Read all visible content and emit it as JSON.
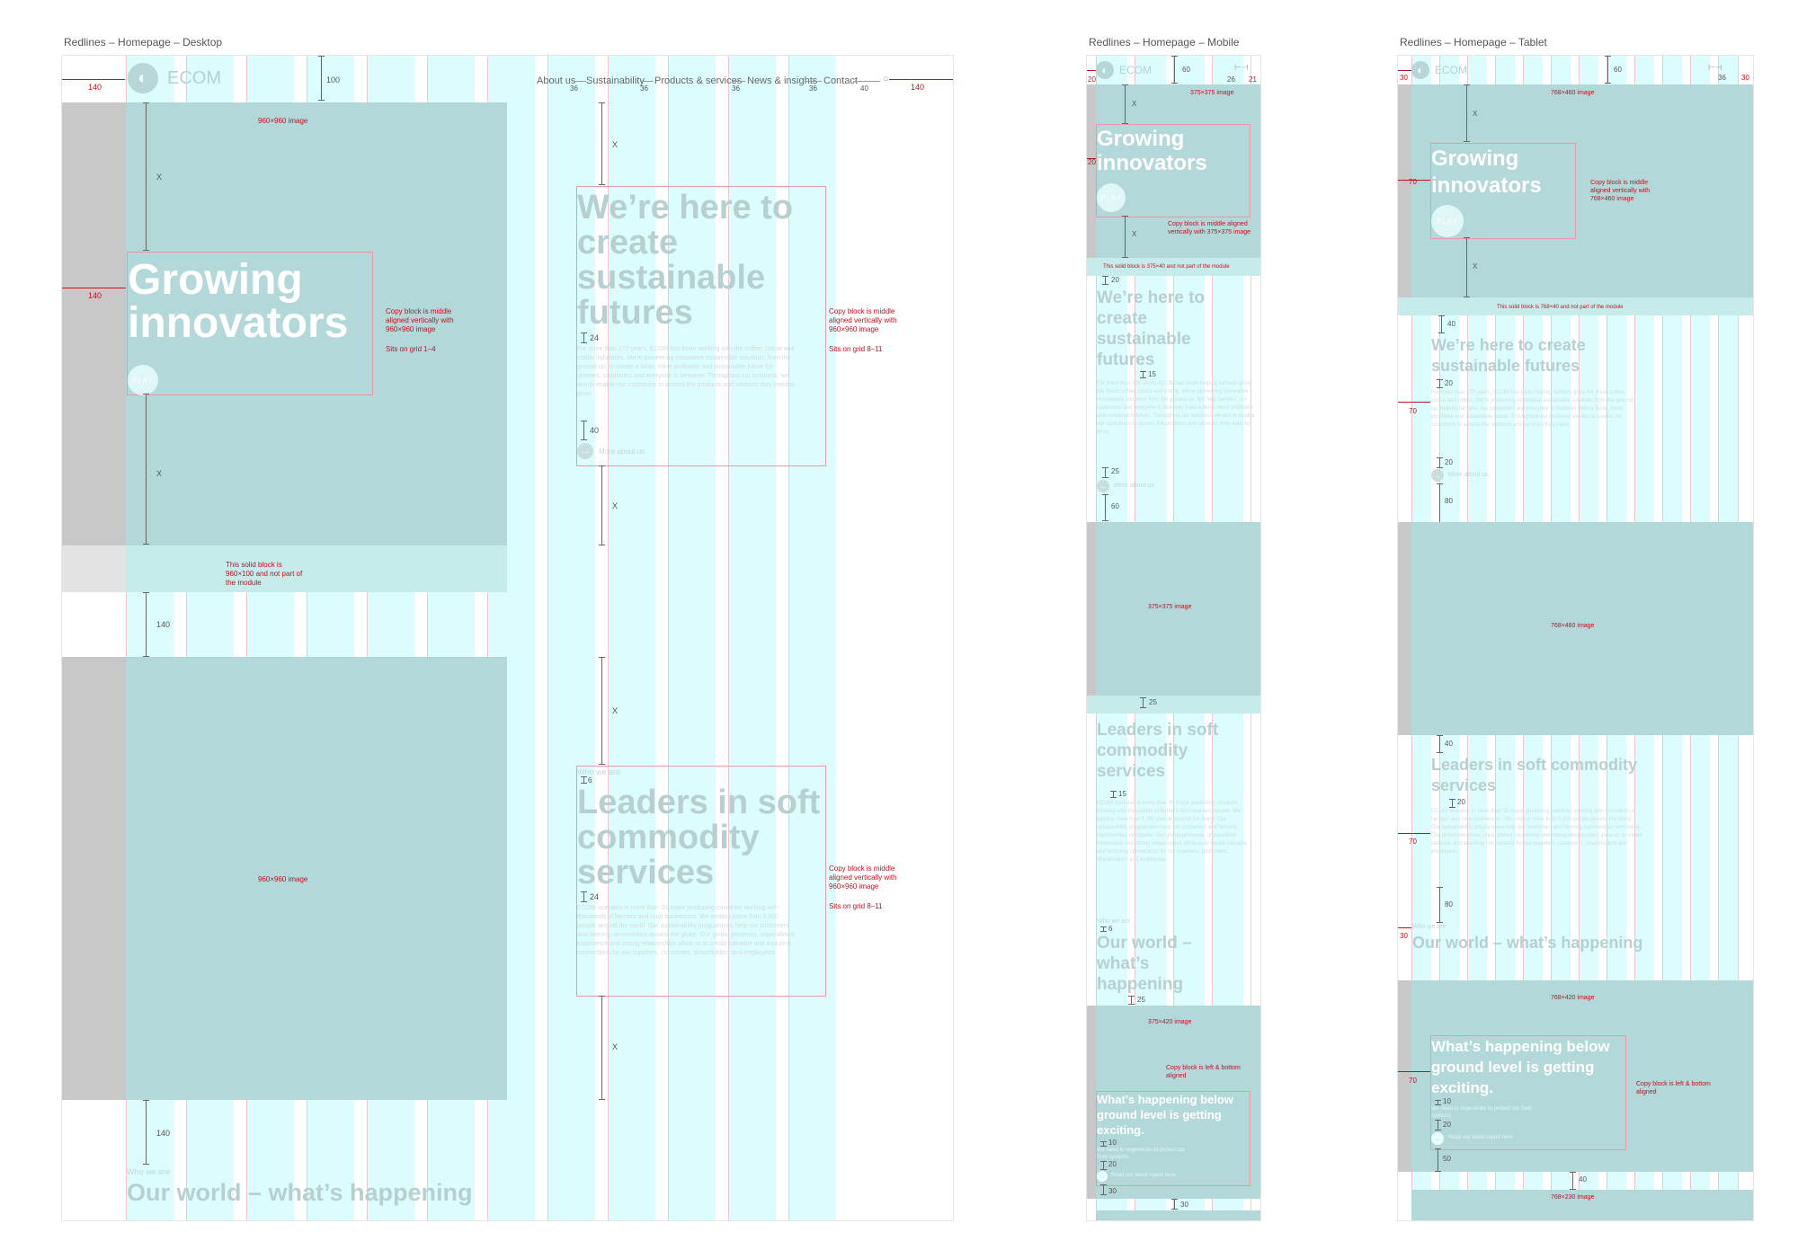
{
  "frames": {
    "desktop_title": "Redlines – Homepage – Desktop",
    "mobile_title": "Redlines – Homepage – Mobile",
    "tablet_title": "Redlines – Homepage – Tablet"
  },
  "brand": {
    "logo_text": "ECOM",
    "logo_icon": "globe-logo-icon",
    "play_label": "PLAY"
  },
  "colors": {
    "guide_red": "#c0121f",
    "grid_cyan": "#dcfdfd",
    "image_teal": "#b2d8d9",
    "gutter_grey": "#c8c8c8"
  },
  "desktop": {
    "nav": [
      "About us",
      "Sustainability",
      "Products & services",
      "News & insights",
      "Contact"
    ],
    "nav_gaps": [
      "36",
      "36",
      "36",
      "36",
      "40"
    ],
    "margins": {
      "left": "140",
      "right": "140",
      "header_height": "100",
      "section_gap": "140"
    },
    "hero": {
      "image_label": "960×960 image",
      "title": "Growing innovators",
      "x": "X",
      "note": "Copy block is middle aligned vertically with 960×960 image",
      "grid_note": "Sits on grid 1–4",
      "band_note": "This solid block is 960×100 and not part of the module"
    },
    "about": {
      "title": "We’re here to create sustainable futures",
      "body": "For more than 170 years, ECOM has been working with the coffee, cocoa and cotton industries. We're pioneering innovative sustainable solutions, from the ground up, to create a fairer, more profitable and sustainable future for growers, customers and everyone in between. Throughout our business, we aim to enable our customers to access the products and services they need to grow.",
      "gap_title": "24",
      "gap_cta": "40",
      "cta": "More about us",
      "note": "Copy block is middle aligned vertically with 960×960 image",
      "grid_note": "Sits on grid 8–11"
    },
    "second": {
      "image_label": "960×960 image",
      "eyebrow": "Who we are",
      "gap_eyebrow": "6",
      "title": "Leaders in soft commodity services",
      "gap_title": "24",
      "body": "ECOM operates in more than 35 major producing countries working with thousands of farmers and rural businesses. We employ more than 5,000 people around the world. Our sustainability programmes help our customers and farming communities around the globe. Our global presence, unparalleled experience and strong relationships allow us to create valuable and enduring connections for our suppliers, customers, shareholders and employees.",
      "note": "Copy block is middle aligned vertically with 960×960 image",
      "grid_note": "Sits on grid 8–11",
      "x": "X"
    },
    "world": {
      "eyebrow": "Who we are",
      "title": "Our world – what’s happening",
      "gap": "140"
    }
  },
  "mobile": {
    "margin": "20",
    "header_height": "60",
    "right_a": "26",
    "right_b": "21",
    "hero": {
      "image_label": "375×375 image",
      "title": "Growing innovators",
      "x": "X",
      "note": "Copy block is middle aligned vertically with 375×375 image",
      "band_note": "This solid block is 375×40 and not part of the module"
    },
    "about": {
      "gap_top": "20",
      "title": "We’re here to create sustainable futures",
      "gap_title": "15",
      "body": "For more than 170 years, ECOM has been helping farmers grow the finest coffee, cocoa and cotton. We're pioneering innovative sustainable solutions from the ground up. We help farmers, our customers and everyone in between build a fairer, more profitable and sustainable future. Throughout our business we aim to enable our customers to access the products and services they need to grow.",
      "gap_cta": "25",
      "cta": "More about us",
      "gap_bottom": "60"
    },
    "second": {
      "image_label": "375×375 image",
      "gap_top": "25",
      "title": "Leaders in soft commodity services",
      "gap_title": "15",
      "body": "ECOM operates in more than 35 major producing countries working with thousands of farmers and rural businesses. We employ more than 5,000 people around the world. Our sustainability programmes help our customers and farming communities worldwide. Our global presence, unparalleled experience and strong relationships allow us to create valuable and enduring connections for our suppliers, customers, shareholders and employees.",
      "eyebrow": "Who we are",
      "gap_eyebrow": "6"
    },
    "world": {
      "title": "Our world – what’s happening",
      "gap": "25",
      "image_label": "375×420 image",
      "note": "Copy block is left & bottom aligned",
      "card_title": "What’s happening below ground level is getting exciting.",
      "gap_title": "10",
      "card_body": "We need to regenerate to protect our food systems.",
      "gap_cta": "20",
      "cta": "Read our latest report here",
      "gap_bottom": "30",
      "gap_bottom_b": "30"
    }
  },
  "tablet": {
    "margin": "30",
    "header_height": "60",
    "right_a": "36",
    "right_b": "30",
    "hero": {
      "image_label": "768×460 image",
      "title": "Growing innovators",
      "x": "X",
      "margin": "70",
      "note": "Copy block is middle aligned vertically with 768×460 image",
      "band_note": "This solid block is 768×40 and not part of the module"
    },
    "about": {
      "gap_top": "40",
      "title": "We’re here to create sustainable futures",
      "gap_title": "20",
      "body": "For more than 170 years, ECOM has been helping farmers grow the finest coffee, cocoa and cotton. We're pioneering innovative sustainable solutions from the ground up, helping farmers, our customers and everyone in between build a fairer, more profitable and sustainable future. Throughout our business we aim to enable our customers to access the products and services they need.",
      "gap_cta": "20",
      "cta": "More about us",
      "gap_bottom": "80",
      "margin": "70"
    },
    "second": {
      "image_label": "768×460 image",
      "gap_top": "40",
      "title": "Leaders in soft commodity services",
      "gap_title": "20",
      "body": "ECOM operates in more than 35 major producing countries working with thousands of farmers and rural businesses. We employ more than 5,000 people around the world. Our sustainability programmes help our customers and farming communities worldwide. Our global presence, unparalleled experience and strong relationships allow us to create valuable and enduring connections for our suppliers, customers, shareholders and employees.",
      "gap_bottom": "80",
      "margin": "70",
      "eyebrow": "Who we are",
      "eyebrow_margin": "30"
    },
    "world": {
      "title": "Our world – what’s happening",
      "image_label": "768×420 image",
      "card_title": "What’s happening below ground level is getting exciting.",
      "gap_title": "10",
      "card_body": "We need to regenerate to protect our food systems.",
      "gap_cta": "20",
      "cta": "Read our latest report here",
      "gap_bottom": "50",
      "note": "Copy block is left & bottom aligned",
      "margin": "70",
      "gap_next": "40",
      "next_label": "768×230 image"
    }
  }
}
